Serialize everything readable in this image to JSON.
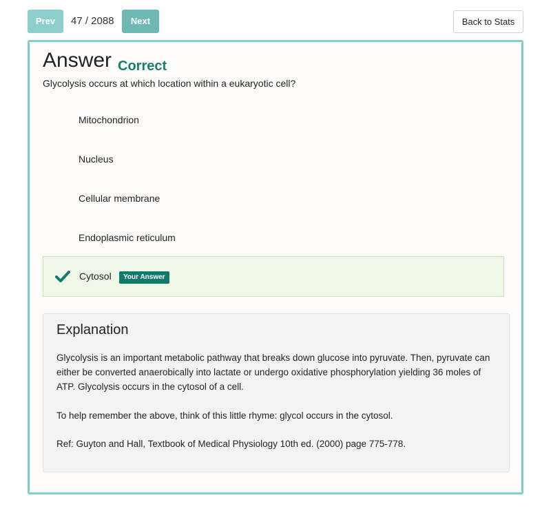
{
  "nav": {
    "prev_label": "Prev",
    "counter": "47 / 2088",
    "next_label": "Next",
    "back_label": "Back to Stats"
  },
  "answer": {
    "title": "Answer",
    "status": "Correct",
    "question": "Glycolysis occurs at which location within a eukaryotic cell?"
  },
  "options": [
    {
      "label": "Mitochondrion"
    },
    {
      "label": "Nucleus"
    },
    {
      "label": "Cellular membrane"
    },
    {
      "label": "Endoplasmic reticulum"
    },
    {
      "label": "Cytosol",
      "badge": "Your Answer",
      "selected": true
    }
  ],
  "explanation": {
    "title": "Explanation",
    "p1": "Glycolysis is an important metabolic pathway that breaks down glucose into pyruvate. Then, pyruvate can either be converted anaerobically into lactate or undergo oxidative phosphorylation yielding 36 moles of ATP. Glycolysis occurs in the cytosol of a cell.",
    "p2": "To help remember the above, think of this little rhyme: glycol occurs in the cytosol.",
    "p3": "Ref: Guyton and Hall, Textbook of Medical Physiology 10th ed. (2000) page 775-778."
  },
  "colors": {
    "accent": "#7fd0c9",
    "correct": "#17806d",
    "selected_bg": "#eef7e8"
  },
  "icons": {
    "selected_option": "check-icon"
  }
}
